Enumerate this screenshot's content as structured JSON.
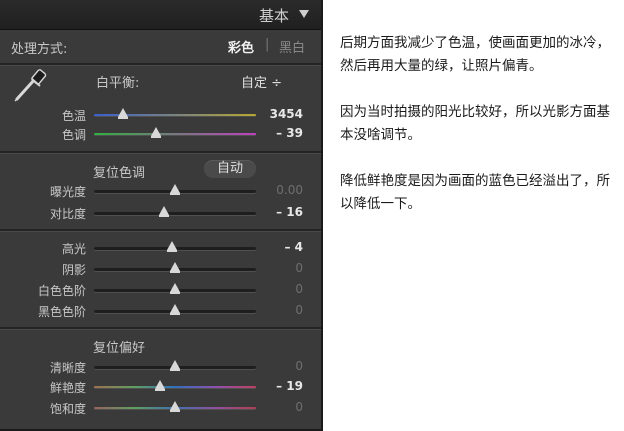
{
  "panel": {
    "title": "基本",
    "treatment_label": "处理方式:",
    "treatment_color": "彩色",
    "treatment_divider": "|",
    "treatment_bw": "黑白",
    "wb_label": "白平衡:",
    "wb_value": "自定 ÷",
    "tone_reset_label": "复位色调",
    "auto_label": "自动",
    "presence_reset_label": "复位偏好",
    "sliders": [
      {
        "label": "色温",
        "value": "3454",
        "pos": 0.18,
        "dim": false,
        "track": "temp"
      },
      {
        "label": "色调",
        "value": "– 39",
        "pos": 0.38,
        "dim": false,
        "track": "tint"
      },
      {
        "label": "曝光度",
        "value": "0.00",
        "pos": 0.5,
        "dim": true,
        "track": "plain"
      },
      {
        "label": "对比度",
        "value": "– 16",
        "pos": 0.43,
        "dim": false,
        "track": "plain"
      },
      {
        "label": "高光",
        "value": "– 4",
        "pos": 0.48,
        "dim": false,
        "track": "plain"
      },
      {
        "label": "阴影",
        "value": "0",
        "pos": 0.5,
        "dim": true,
        "track": "plain"
      },
      {
        "label": "白色色阶",
        "value": "0",
        "pos": 0.5,
        "dim": true,
        "track": "plain"
      },
      {
        "label": "黑色色阶",
        "value": "0",
        "pos": 0.5,
        "dim": true,
        "track": "plain"
      },
      {
        "label": "清晰度",
        "value": "0",
        "pos": 0.5,
        "dim": true,
        "track": "plain"
      },
      {
        "label": "鲜艳度",
        "value": "– 19",
        "pos": 0.41,
        "dim": false,
        "track": "vib"
      },
      {
        "label": "饱和度",
        "value": "0",
        "pos": 0.5,
        "dim": true,
        "track": "sat"
      }
    ]
  },
  "notes": {
    "p1": "后期方面我减少了色温，使画面更加的冰冷，然后再用大量的绿，让照片偏青。",
    "p2": "因为当时拍摄的阳光比较好，所以光影方面基本没啥调节。",
    "p3": "降低鲜艳度是因为画面的蓝色已经溢出了，所以降低一下。"
  },
  "colors": {
    "panel_bg": "#3a3a3a",
    "temp_gradient": [
      "#3a5fd0",
      "#b8a830"
    ],
    "tint_gradient": [
      "#30b040",
      "#c040c0"
    ]
  }
}
